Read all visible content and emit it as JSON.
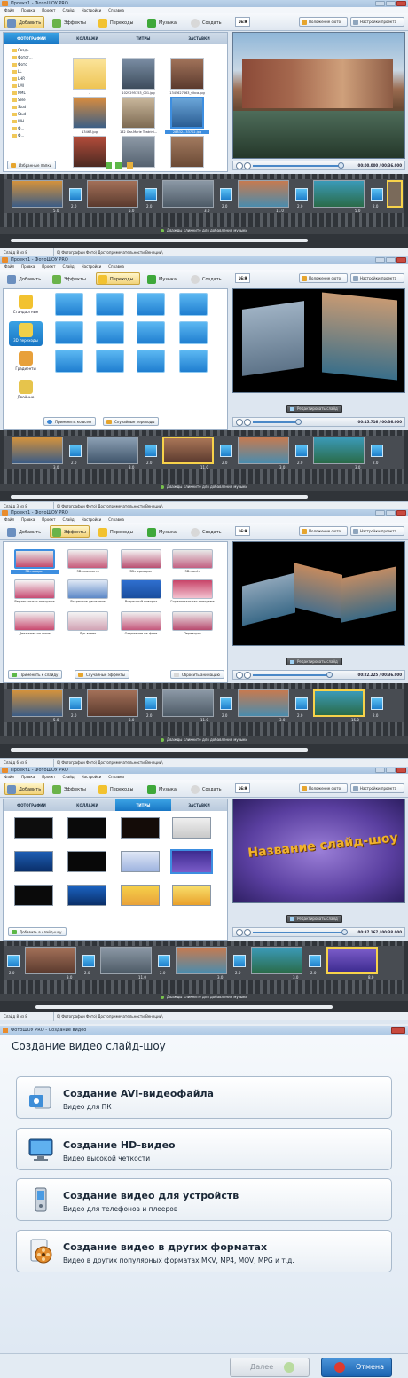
{
  "app": {
    "title": "Проект1 - ФотоШОУ PRO",
    "menu": [
      "Файл",
      "Правка",
      "Проект",
      "Слайд",
      "Настройки",
      "Справка"
    ],
    "toolbar": {
      "add": "Добавить",
      "effects": "Эффекты",
      "transitions": "Переходы",
      "music": "Музыка",
      "create": "Создать",
      "ratio": "16:9",
      "photo_position": "Положение фото",
      "project_settings": "Настройки проекта"
    },
    "edit_slide": "Редактировать слайд",
    "music_hint": "Дважды кликните для добавления музыки",
    "status_path": "0) Фотографии Фото\\ Достопримечательности Венеции\\"
  },
  "screen1": {
    "tabs": [
      "ФОТОГРАФИИ",
      "КОЛЛАЖИ",
      "ТИТРЫ",
      "ЗАСТАВКИ"
    ],
    "tree": [
      "Свадь...",
      "Фотог...",
      "Фото",
      "LL",
      "LHR",
      "LMI",
      "NML",
      "Sele",
      "Stud",
      "Stud",
      "WH",
      "Ф...",
      "Ф..."
    ],
    "files": [
      "..",
      "1029295753_001.jpg",
      "1345627663_sikca.jpg",
      "13467.jpg",
      "182 Gar-Marie Teatrini...",
      "28832...33702.jpg"
    ],
    "favorites_btn": "Избранные папки",
    "time": "00:00.000 / 00:36.000",
    "status_slide": "Слайд 8 из 8",
    "durations": [
      "5.0",
      "2.0",
      "5.0",
      "2.0",
      "3.0",
      "2.0",
      "11.0",
      "2.0",
      "5.0",
      "2.0",
      "5.0",
      "2.0",
      "5.0"
    ]
  },
  "screen2": {
    "categories": [
      "Стандартные",
      "3D переходы",
      "Градиенты",
      "Двойные"
    ],
    "apply_all": "Применить ко всем",
    "random_transitions": "Случайные переходы",
    "time": "00:15.716 / 00:36.000",
    "status_slide": "Слайд 3 из 8",
    "durations": [
      "3.0",
      "2.0",
      "3.0",
      "2.0",
      "11.0",
      "2.0",
      "3.0",
      "2.0",
      "3.0",
      "2.0"
    ]
  },
  "screen3": {
    "effects": [
      "3D-поворот",
      "3D-плоскость",
      "3D-переворот",
      "3D-полёт",
      "Вертикальная панорама",
      "Встречное движение",
      "Встречный поворот",
      "Горизонтальная панорама",
      "Движение на фоне",
      "Лук влево",
      "Отдаление на фоне",
      "Переворот"
    ],
    "apply_to_slide": "Применить к слайду",
    "random_effects": "Случайные эффекты",
    "reset_animation": "Сбросить анимацию",
    "time": "00:22.225 / 00:36.000",
    "status_slide": "Слайд 6 из 8",
    "durations": [
      "5.0",
      "2.0",
      "3.0",
      "2.0",
      "11.0",
      "2.0",
      "3.0",
      "2.0",
      "15.0",
      "2.0"
    ]
  },
  "screen4": {
    "tabs": [
      "ФОТОГРАФИИ",
      "КОЛЛАЖИ",
      "ТИТРЫ",
      "ЗАСТАВКИ"
    ],
    "add_to_show": "Добавить в слайд-шоу",
    "preview_text": "Название слайд-шоу",
    "time": "00:37.167 / 00:38.000",
    "status_slide": "Слайд 8 из 8",
    "durations": [
      "2.0",
      "3.0",
      "2.0",
      "11.0",
      "2.0",
      "3.0",
      "2.0",
      "3.0",
      "2.0",
      "8.0"
    ]
  },
  "dialog": {
    "window_title": "ФотоШОУ PRO - Создание видео",
    "heading": "Создание видео слайд-шоу",
    "options": [
      {
        "title": "Создание AVI-видеофайла",
        "subtitle": "Видео для ПК",
        "icon": "avi-file-icon"
      },
      {
        "title": "Создание HD-видео",
        "subtitle": "Видео высокой четкости",
        "icon": "hd-monitor-icon"
      },
      {
        "title": "Создание видео для устройств",
        "subtitle": "Видео для телефонов и плееров",
        "icon": "phone-device-icon"
      },
      {
        "title": "Создание видео в других форматах",
        "subtitle": "Видео в других популярных форматах MKV, MP4, MOV, MPG и т.д.",
        "icon": "film-reel-icon"
      }
    ],
    "next": "Далее",
    "cancel": "Отмена"
  }
}
